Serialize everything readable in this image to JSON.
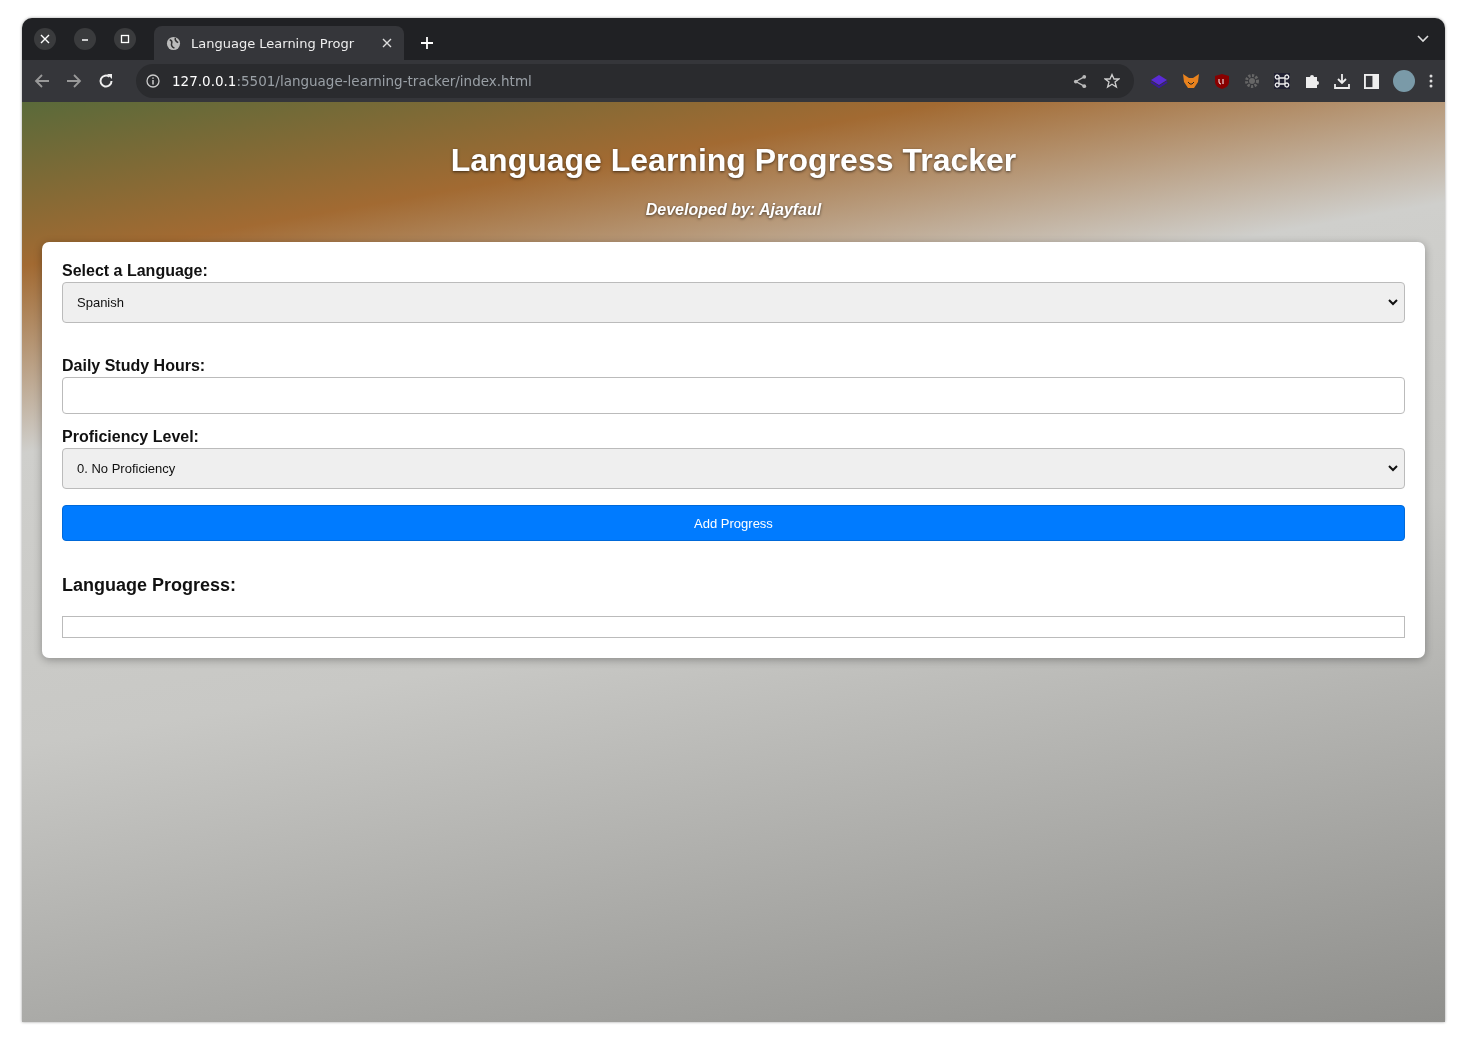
{
  "browser": {
    "tab_title": "Language Learning Progr",
    "url_host": "127.0.0.1",
    "url_path": ":5501/language-learning-tracker/index.html"
  },
  "header": {
    "title": "Language Learning Progress Tracker",
    "subtitle": "Developed by: Ajayfaul"
  },
  "form": {
    "fields": [
      {
        "kind": "select",
        "label": "Select a Language:",
        "value": "Spanish"
      },
      {
        "kind": "input",
        "label": "Daily Study Hours:"
      },
      {
        "kind": "select",
        "label": "Proficiency Level:",
        "value": "0. No Proficiency"
      }
    ],
    "button": "Add Progress"
  },
  "progress": {
    "heading": "Language Progress:"
  }
}
